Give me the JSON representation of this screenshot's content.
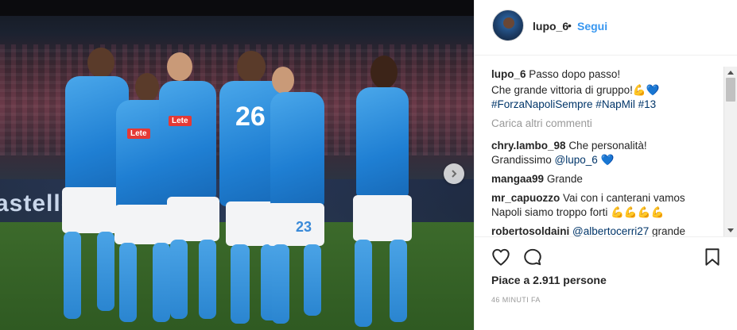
{
  "post": {
    "overlay_text": "astello"
  },
  "header": {
    "username": "lupo_6",
    "separator": "•",
    "follow_label": "Segui"
  },
  "caption": {
    "username": "lupo_6",
    "line1": "Passo dopo passo!",
    "line2": "Che grande vittoria di gruppo!💪💙",
    "hashtags": "#ForzaNapoliSempre #NapMil #13"
  },
  "load_more_label": "Carica altri commenti",
  "comments": [
    {
      "user": "chry.lambo_98",
      "text": "Che personalità!",
      "text2": "Grandissimo ",
      "mention": "@lupo_6",
      "suffix": " 💙"
    },
    {
      "user": "mangaa99",
      "text": "Grande"
    },
    {
      "user": "mr_capuozzo",
      "text": "Vai con i canterani vamos",
      "text2": "Napoli siamo troppo forti 💪💪💪💪"
    },
    {
      "user": "robertosoldaini",
      "mention": "@albertocerri27",
      "text": " grande"
    }
  ],
  "likes_label": "Piace a 2.911 persone",
  "timestamp": "46 MINUTI FA",
  "icons": [
    "heart-icon",
    "comment-icon",
    "bookmark-icon",
    "chevron-right-icon"
  ],
  "colors": {
    "link": "#3897f0",
    "text": "#262626",
    "muted": "#999999",
    "border": "#efefef"
  }
}
